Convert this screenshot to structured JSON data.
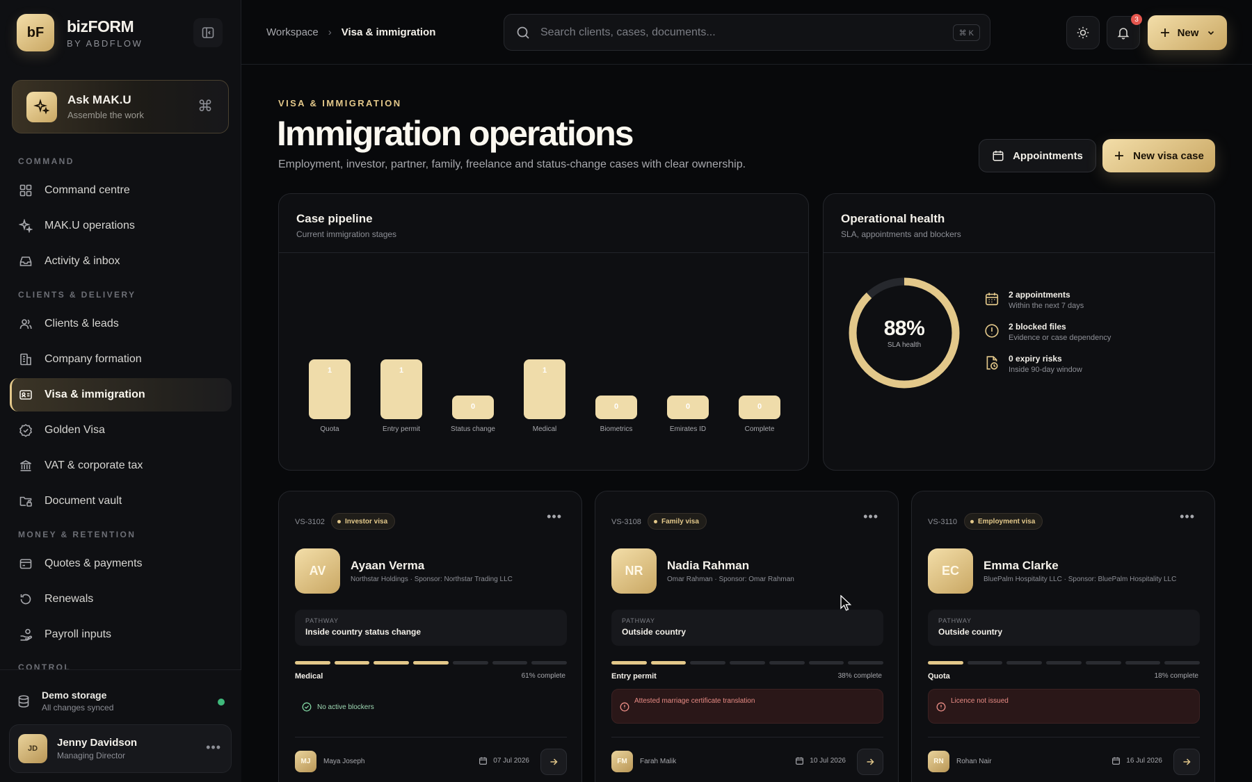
{
  "brand": {
    "logo": "bF",
    "name": "bizFORM",
    "sub": "BY ABDFLOW"
  },
  "ask": {
    "title": "Ask MAK.U",
    "sub": "Assemble the work",
    "shortcut": "⌘"
  },
  "sections": {
    "command": "COMMAND",
    "clients": "CLIENTS & DELIVERY",
    "money": "MONEY & RETENTION",
    "control": "CONTROL"
  },
  "nav": {
    "command_centre": "Command centre",
    "maku_ops": "MAK.U operations",
    "activity": "Activity & inbox",
    "clients": "Clients & leads",
    "company": "Company formation",
    "visa": "Visa & immigration",
    "golden": "Golden Visa",
    "vat": "VAT & corporate tax",
    "vault": "Document vault",
    "quotes": "Quotes & payments",
    "renewals": "Renewals",
    "payroll": "Payroll inputs"
  },
  "storage": {
    "title": "Demo storage",
    "sub": "All changes synced",
    "status_color": "#3fb97b"
  },
  "user": {
    "initials": "JD",
    "name": "Jenny Davidson",
    "role": "Managing Director",
    "more": "•••"
  },
  "topbar": {
    "crumb_root": "Workspace",
    "crumb_sep": "›",
    "crumb_current": "Visa & immigration",
    "search_placeholder": "Search clients, cases, documents...",
    "search_kbd": "⌘ K",
    "notif_count": "3",
    "new_label": "New"
  },
  "header": {
    "eyebrow": "VISA & IMMIGRATION",
    "title": "Immigration operations",
    "subtitle": "Employment, investor, partner, family, freelance and status-change cases with clear ownership.",
    "appointments_label": "Appointments",
    "new_case_label": "New visa case"
  },
  "pipeline": {
    "title": "Case pipeline",
    "subtitle": "Current immigration stages"
  },
  "chart_data": {
    "type": "bar",
    "categories": [
      "Quota",
      "Entry permit",
      "Status change",
      "Medical",
      "Biometrics",
      "Emirates ID",
      "Complete"
    ],
    "values": [
      1,
      1,
      0,
      1,
      0,
      0,
      0
    ],
    "title": "Case pipeline",
    "subtitle": "Current immigration stages",
    "ylim": [
      0,
      1
    ],
    "grid": false,
    "color": "#e3c88a"
  },
  "health": {
    "title": "Operational health",
    "subtitle": "SLA, appointments and blockers",
    "sla_value": "88%",
    "sla_fraction": 0.88,
    "sla_label": "SLA health",
    "items": [
      {
        "icon": "calendar-icon",
        "title": "2 appointments",
        "sub": "Within the next 7 days"
      },
      {
        "icon": "alert-circle-icon",
        "title": "2 blocked files",
        "sub": "Evidence or case dependency"
      },
      {
        "icon": "file-clock-icon",
        "title": "0 expiry risks",
        "sub": "Inside 90-day window"
      }
    ]
  },
  "cases": [
    {
      "id": "VS-3102",
      "tag": "Investor visa",
      "initials": "AV",
      "name": "Ayaan Verma",
      "org": "Northstar Holdings · Sponsor: Northstar Trading LLC",
      "pathway_label": "PATHWAY",
      "pathway": "Inside country status change",
      "steps_done": 4,
      "steps_total": 7,
      "stage": "Medical",
      "pct": "61% complete",
      "status_text": "No active blockers",
      "owner_initials": "MJ",
      "owner": "Maya Joseph",
      "due": "07 Jul 2026"
    },
    {
      "id": "VS-3108",
      "tag": "Family visa",
      "initials": "NR",
      "name": "Nadia Rahman",
      "org": "Omar Rahman · Sponsor: Omar Rahman",
      "pathway_label": "PATHWAY",
      "pathway": "Outside country",
      "steps_done": 2,
      "steps_total": 7,
      "stage": "Entry permit",
      "pct": "38% complete",
      "status_text": "Attested marriage certificate translation",
      "owner_initials": "FM",
      "owner": "Farah Malik",
      "due": "10 Jul 2026"
    },
    {
      "id": "VS-3110",
      "tag": "Employment visa",
      "initials": "EC",
      "name": "Emma Clarke",
      "org": "BluePalm Hospitality LLC · Sponsor: BluePalm Hospitality LLC",
      "pathway_label": "PATHWAY",
      "pathway": "Outside country",
      "steps_done": 1,
      "steps_total": 7,
      "stage": "Quota",
      "pct": "18% complete",
      "status_text": "Licence not issued",
      "owner_initials": "RN",
      "owner": "Rohan Nair",
      "due": "16 Jul 2026"
    }
  ],
  "card_more": "•••"
}
